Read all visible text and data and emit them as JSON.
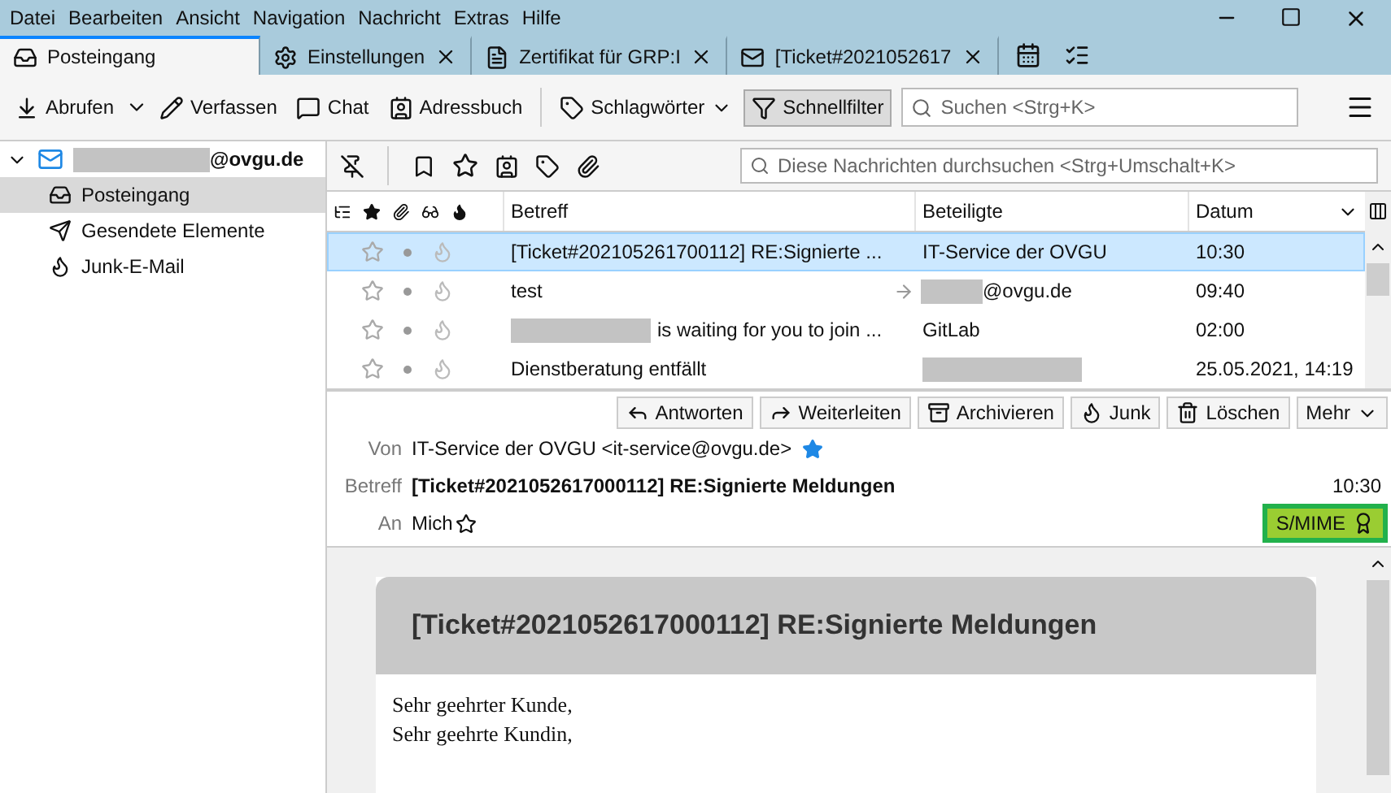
{
  "menu": [
    "Datei",
    "Bearbeiten",
    "Ansicht",
    "Navigation",
    "Nachricht",
    "Extras",
    "Hilfe"
  ],
  "tabs": [
    {
      "label": "Posteingang",
      "selected": true,
      "closable": false
    },
    {
      "label": "Einstellungen",
      "selected": false,
      "closable": true
    },
    {
      "label": "Zertifikat für GRP:I",
      "selected": false,
      "closable": true
    },
    {
      "label": "[Ticket#2021052617",
      "selected": false,
      "closable": true
    }
  ],
  "toolbar": [
    {
      "label": "Abrufen",
      "kind": "split"
    },
    {
      "label": "Verfassen",
      "kind": "plain"
    },
    {
      "label": "Chat",
      "kind": "plain"
    },
    {
      "label": "Adressbuch",
      "kind": "plain"
    },
    {
      "label": "Schlagwörter",
      "kind": "dropdown"
    },
    {
      "label": "Schnellfilter",
      "kind": "toggle",
      "pressed": true
    }
  ],
  "search": {
    "placeholder": "Suchen <Strg+K>"
  },
  "account": {
    "label": "@ovgu.de",
    "expanded": true
  },
  "folders": [
    {
      "label": "Posteingang",
      "selected": true
    },
    {
      "label": "Gesendete Elemente",
      "selected": false
    },
    {
      "label": "Junk-E-Mail",
      "selected": false
    }
  ],
  "filter": {
    "placeholder": "Diese Nachrichten durchsuchen <Strg+Umschalt+K>"
  },
  "columns": [
    "Betreff",
    "Beteiligte",
    "Datum"
  ],
  "rows": [
    {
      "subject": "[Ticket#202105261700112] RE:Signierte ...",
      "subject_redacted": false,
      "from": "IT-Service der OVGU",
      "from_redacted": false,
      "outgoing": false,
      "date": "10:30",
      "selected": true
    },
    {
      "subject": "test",
      "subject_redacted": false,
      "from": "@ovgu.de",
      "from_redacted": true,
      "outgoing": true,
      "date": "09:40",
      "selected": false
    },
    {
      "subject": "is waiting for you to join ...",
      "subject_redacted": true,
      "from": "GitLab",
      "from_redacted": false,
      "outgoing": false,
      "date": "02:00",
      "selected": false
    },
    {
      "subject": "Dienstberatung entfällt",
      "subject_redacted": false,
      "from_redacted": true,
      "outgoing": false,
      "date": "25.05.2021, 14:19",
      "selected": false
    }
  ],
  "actions": [
    "Antworten",
    "Weiterleiten",
    "Archivieren",
    "Junk",
    "Löschen",
    "Mehr"
  ],
  "header": {
    "from_label": "Von",
    "from": "IT-Service der OVGU <it-service@ovgu.de>",
    "from_starred": true,
    "subject_label": "Betreff",
    "subject": "[Ticket#2021052617000112] RE:Signierte Meldungen",
    "time": "10:30",
    "to_label": "An",
    "to": "Mich",
    "to_starred": false,
    "security": "S/MIME"
  },
  "body": {
    "title": "[Ticket#2021052617000112] RE:Signierte Meldungen",
    "lines": [
      "Sehr geehrter Kunde,",
      "Sehr geehrte Kundin,"
    ]
  }
}
